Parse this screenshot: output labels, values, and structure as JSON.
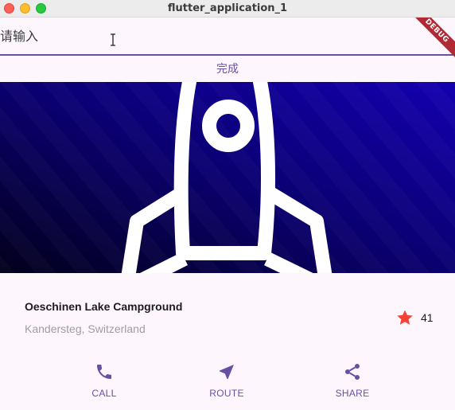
{
  "window": {
    "title": "flutter_application_1"
  },
  "input": {
    "placeholder": "请输入",
    "value": ""
  },
  "debug_banner": {
    "label": "DEBUG"
  },
  "done_button": {
    "label": "完成"
  },
  "place": {
    "title": "Oeschinen Lake Campground",
    "location": "Kandersteg, Switzerland",
    "rating_count": "41"
  },
  "actions": [
    {
      "label": "CALL",
      "icon": "phone-icon"
    },
    {
      "label": "ROUTE",
      "icon": "navigation-icon"
    },
    {
      "label": "SHARE",
      "icon": "share-icon"
    }
  ],
  "colors": {
    "accent": "#6750a4",
    "star": "#f44336",
    "hero_dark": "#04002a",
    "hero_light": "#1200a8"
  }
}
